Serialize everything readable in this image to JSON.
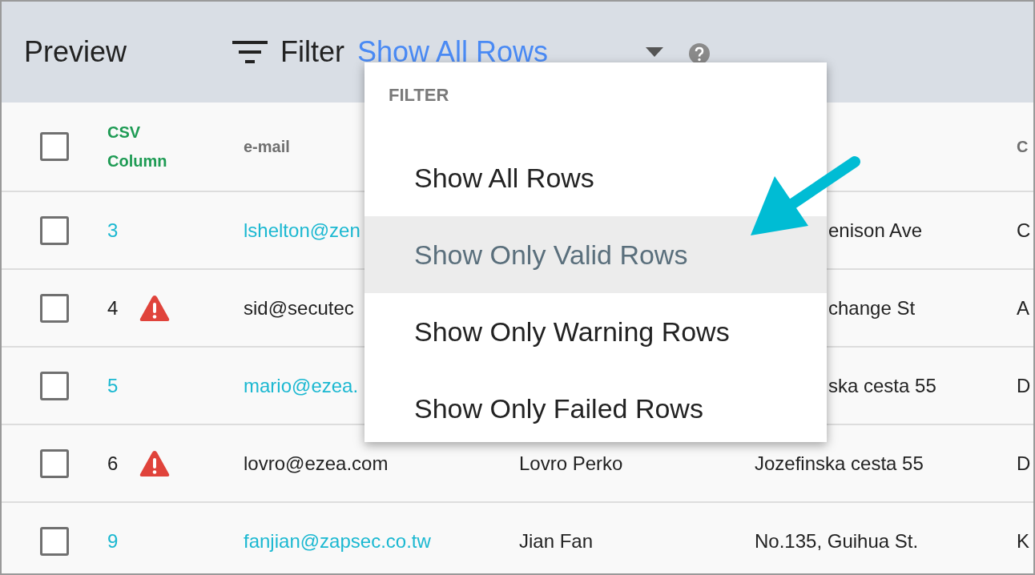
{
  "header": {
    "title": "Preview",
    "filter_label": "Filter",
    "filter_value": "Show All Rows"
  },
  "table": {
    "header_checkbox": {
      "checked": false
    },
    "columns": {
      "csv_column": "CSV Column",
      "email": "e-mail",
      "column_6": "C"
    },
    "rows": [
      {
        "checked": false,
        "row": "3",
        "kind": "valid",
        "email": "lshelton@zen",
        "address": "enison Ave",
        "column_6": "C"
      },
      {
        "checked": false,
        "row": "4",
        "kind": "warning",
        "email": "sid@secutec",
        "address": "change St",
        "column_6": "A"
      },
      {
        "checked": false,
        "row": "5",
        "kind": "valid",
        "email": "mario@ezea.",
        "address": "ska cesta 55",
        "column_6": "D"
      },
      {
        "checked": false,
        "row": "6",
        "kind": "warning",
        "email": "lovro@ezea.com",
        "name": "Lovro Perko",
        "address": "Jozefinska cesta 55",
        "column_6": "D"
      },
      {
        "checked": false,
        "row": "9",
        "kind": "valid",
        "email": "fanjian@zapsec.co.tw",
        "name": "Jian Fan",
        "address": "No.135, Guihua St.",
        "column_6": "K"
      }
    ]
  },
  "filter_menu": {
    "heading": "FILTER",
    "items": [
      {
        "label": "Show All Rows",
        "highlighted": false
      },
      {
        "label": "Show Only Valid Rows",
        "highlighted": true
      },
      {
        "label": "Show Only Warning Rows",
        "highlighted": false
      },
      {
        "label": "Show Only Failed Rows",
        "highlighted": false
      }
    ]
  }
}
